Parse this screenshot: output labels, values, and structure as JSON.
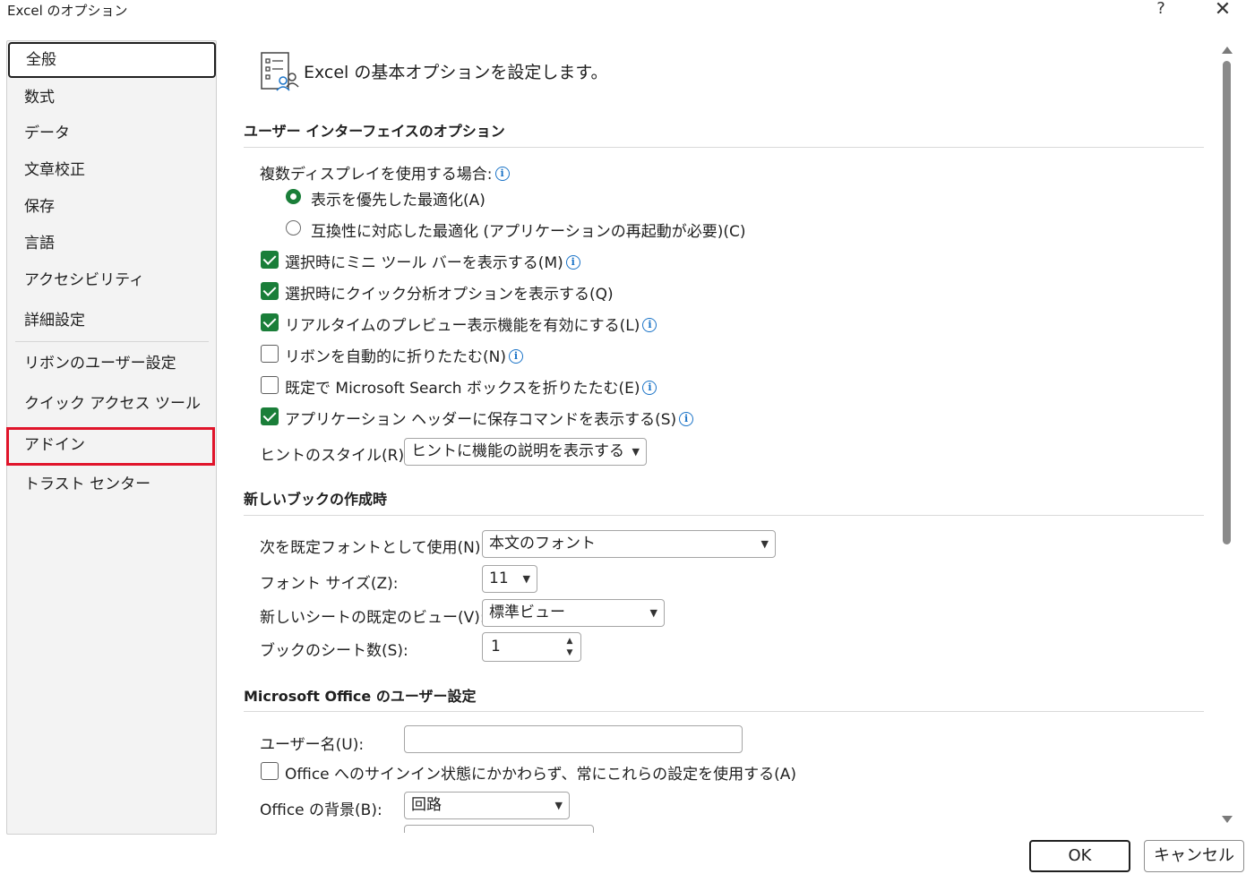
{
  "window": {
    "title": "Excel のオプション",
    "help_glyph": "?",
    "close_glyph": "✕"
  },
  "sidebar": {
    "items": [
      {
        "label": "全般"
      },
      {
        "label": "数式"
      },
      {
        "label": "データ"
      },
      {
        "label": "文章校正"
      },
      {
        "label": "保存"
      },
      {
        "label": "言語"
      },
      {
        "label": "アクセシビリティ"
      },
      {
        "label": "詳細設定"
      },
      {
        "label": "リボンのユーザー設定"
      },
      {
        "label": "クイック アクセス ツール バー"
      },
      {
        "label": "アドイン"
      },
      {
        "label": "トラスト センター"
      }
    ]
  },
  "header": {
    "text": "Excel の基本オプションを設定します。"
  },
  "ui_options": {
    "title": "ユーザー インターフェイスのオプション",
    "multi_display_label": "複数ディスプレイを使用する場合:",
    "radio_optimize_display": "表示を優先した最適化(A)",
    "radio_optimize_compat": "互換性に対応した最適化 (アプリケーションの再起動が必要)(C)",
    "check_mini_toolbar": "選択時にミニ ツール バーを表示する(M)",
    "check_quick_analysis": "選択時にクイック分析オプションを表示する(Q)",
    "check_live_preview": "リアルタイムのプレビュー表示機能を有効にする(L)",
    "check_collapse_ribbon": "リボンを自動的に折りたたむ(N)",
    "check_collapse_search": "既定で Microsoft Search ボックスを折りたたむ(E)",
    "check_save_commands": "アプリケーション ヘッダーに保存コマンドを表示する(S)",
    "screentip_label": "ヒントのスタイル(R):",
    "screentip_value": "ヒントに機能の説明を表示する"
  },
  "new_workbook": {
    "title": "新しいブックの作成時",
    "font_label": "次を既定フォントとして使用(N):",
    "font_value": "本文のフォント",
    "size_label": "フォント サイズ(Z):",
    "size_value": "11",
    "view_label": "新しいシートの既定のビュー(V):",
    "view_value": "標準ビュー",
    "sheets_label": "ブックのシート数(S):",
    "sheets_value": "1"
  },
  "office_personal": {
    "title": "Microsoft Office のユーザー設定",
    "username_label": "ユーザー名(U):",
    "username_value": "",
    "always_use_label": "Office へのサインイン状態にかかわらず、常にこれらの設定を使用する(A)",
    "background_label": "Office の背景(B):",
    "background_value": "回路"
  },
  "footer": {
    "ok": "OK",
    "cancel": "キャンセル"
  }
}
